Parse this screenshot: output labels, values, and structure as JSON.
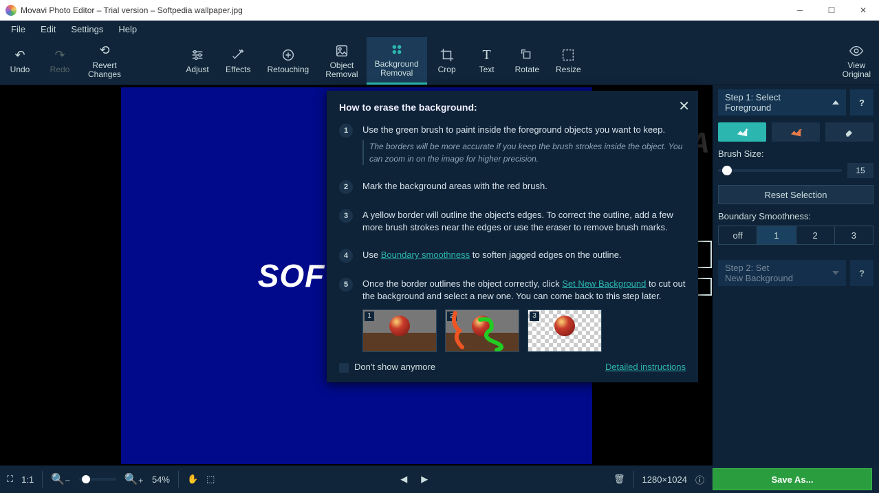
{
  "title": "Movavi Photo Editor – Trial version – Softpedia wallpaper.jpg",
  "menu": [
    "File",
    "Edit",
    "Settings",
    "Help"
  ],
  "toolbar": {
    "undo": "Undo",
    "redo": "Redo",
    "revert": "Revert\nChanges",
    "adjust": "Adjust",
    "effects": "Effects",
    "retouch": "Retouching",
    "objrem": "Object\nRemoval",
    "bgrem": "Background\nRemoval",
    "crop": "Crop",
    "text": "Text",
    "rotate": "Rotate",
    "resize": "Resize",
    "vieworig": "View\nOriginal"
  },
  "canvas": {
    "watermark": "SOFTPEDIA",
    "wm_sup": "®"
  },
  "popup": {
    "title": "How to erase the background:",
    "s1": "Use the green brush to paint inside the foreground objects you want to keep.",
    "s1_hint": "The borders will be more accurate if you keep the brush strokes inside the object. You can zoom in on the image for higher precision.",
    "s2": "Mark the background areas with the red brush.",
    "s3": "A yellow border will outline the object's edges. To correct the outline, add a few more brush strokes near the edges or use the eraser to remove brush marks.",
    "s4_a": "Use ",
    "s4_link": "Boundary smoothness",
    "s4_b": " to soften jagged edges on the outline.",
    "s5_a": "Once the border outlines the object correctly, click ",
    "s5_link": "Set New Background",
    "s5_b": " to cut out the background and select a new one. You can come back to this step later.",
    "dontshow": "Don't show anymore",
    "detailed": "Detailed instructions"
  },
  "side": {
    "step1": "Step 1: Select\nForeground",
    "brush_label": "Brush Size:",
    "brush_val": "15",
    "reset": "Reset Selection",
    "smooth_label": "Boundary Smoothness:",
    "seg": [
      "off",
      "1",
      "2",
      "3"
    ],
    "step2": "Step 2: Set\nNew Background",
    "help": "?"
  },
  "status": {
    "fit": "1:1",
    "zoom": "54%",
    "dims": "1280×1024",
    "save": "Save As..."
  }
}
